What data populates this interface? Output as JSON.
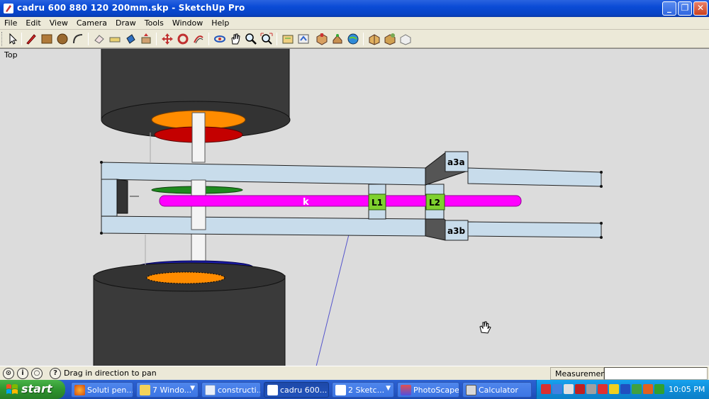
{
  "window": {
    "title": "cadru 600 880 120 200mm.skp - SketchUp Pro",
    "minimize": "_",
    "maximize": "❐",
    "close": "✕"
  },
  "menu": [
    "File",
    "Edit",
    "View",
    "Camera",
    "Draw",
    "Tools",
    "Window",
    "Help"
  ],
  "toolbar": {
    "icons": [
      "select-icon",
      "pencil-icon",
      "rectangle-icon",
      "circle-icon",
      "arc-icon",
      "eraser-icon",
      "tape-measure-icon",
      "paint-bucket-icon",
      "push-pull-icon",
      "move-icon",
      "rotate-icon",
      "offset-icon",
      "orbit-icon",
      "pan-icon",
      "zoom-icon",
      "zoom-extents-icon",
      "get-models-icon",
      "share-model-icon",
      "component-icon",
      "google-earth-icon",
      "warehouse-icon",
      "layout-icon",
      "extension-icon"
    ]
  },
  "viewport": {
    "view_label": "Top",
    "labels": {
      "k": "k",
      "L1": "L1",
      "L2": "L2",
      "a3a": "a3a",
      "a3b": "a3b"
    },
    "colors": {
      "background": "#dcdcdc",
      "wheel": "#3a3a3a",
      "axle_rod": "#ff00ff",
      "frame": "#c8dceb",
      "label_box": "#7fd12f",
      "orange_disc": "#ff8c00",
      "red_disc": "#c40000",
      "green_disc": "#1f8a1f",
      "blue_disc": "#1a1aa6"
    }
  },
  "statusbar": {
    "hint": "Drag in direction to pan",
    "measurements_label": "Measurements",
    "measurements_value": ""
  },
  "taskbar": {
    "start": "start",
    "tasks": [
      {
        "label": "Soluti pen...",
        "icon": "firefox-icon",
        "active": false,
        "arrow": false
      },
      {
        "label": "7 Windo...",
        "icon": "folder-icon",
        "active": false,
        "arrow": true
      },
      {
        "label": "constructi...",
        "icon": "document-icon",
        "active": false,
        "arrow": false
      },
      {
        "label": "cadru 600...",
        "icon": "sketchup-icon",
        "active": true,
        "arrow": false
      },
      {
        "label": "2 Sketc...",
        "icon": "sketchup-icon",
        "active": false,
        "arrow": true
      },
      {
        "label": "PhotoScape",
        "icon": "photoscape-icon",
        "active": false,
        "arrow": false
      },
      {
        "label": "Calculator",
        "icon": "calculator-icon",
        "active": false,
        "arrow": false
      }
    ],
    "clock": "10:05 PM"
  }
}
